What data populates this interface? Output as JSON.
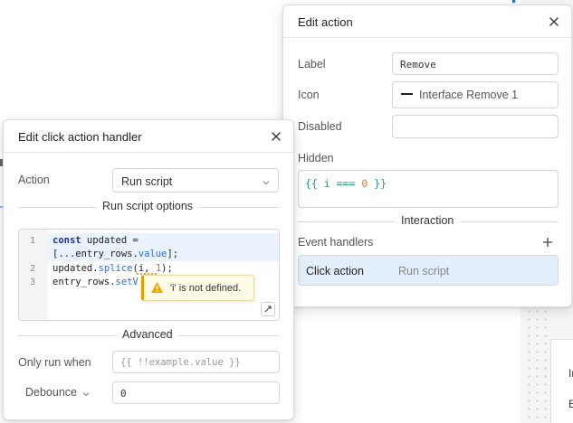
{
  "colors": {
    "accent": "#1d6fe0",
    "selected_row": "#e3eefb",
    "warning": "#e0a100",
    "template_green": "#1f9e72"
  },
  "edit_action": {
    "title": "Edit action",
    "close_icon": "close-icon",
    "label": {
      "label": "Label",
      "value": "Remove"
    },
    "icon": {
      "label": "Icon",
      "value": "Interface Remove 1"
    },
    "disabled": {
      "label": "Disabled",
      "value": ""
    },
    "hidden": {
      "label": "Hidden",
      "open": "{{ i === ",
      "num": "0",
      "close": " }}"
    },
    "interaction_heading": "Interaction",
    "event_handlers_label": "Event handlers",
    "add_icon": "plus-icon",
    "handlers": [
      {
        "event": "Click action",
        "action": "Run script"
      }
    ]
  },
  "edit_handler": {
    "title": "Edit click action handler",
    "close_icon": "close-icon",
    "action": {
      "label": "Action",
      "value": "Run script"
    },
    "script_options_heading": "Run script options",
    "code": {
      "line_numbers": [
        "1",
        "2",
        "3"
      ],
      "line1": {
        "kw": "const",
        "ident": " updated ="
      },
      "line1_wrap": {
        "pre": "[...entry_rows.",
        "prop": "value",
        "post": "];"
      },
      "line2": {
        "pre": "updated.",
        "prop": "splice",
        "open": "(i, ",
        "num": "1",
        "close": ");"
      },
      "line3": {
        "pre": "entry_rows.",
        "prop": "setV"
      }
    },
    "error_tooltip": {
      "icon": "warning-icon",
      "text": "'i' is not defined."
    },
    "expand_icon": "expand-icon",
    "advanced_heading": "Advanced",
    "only_run_when": {
      "label": "Only run when",
      "placeholder": "{{ !!example.value }}"
    },
    "debounce": {
      "label": "Debounce",
      "value": "0"
    }
  },
  "background": {
    "right_card_letters": [
      "Ir",
      "E"
    ]
  }
}
